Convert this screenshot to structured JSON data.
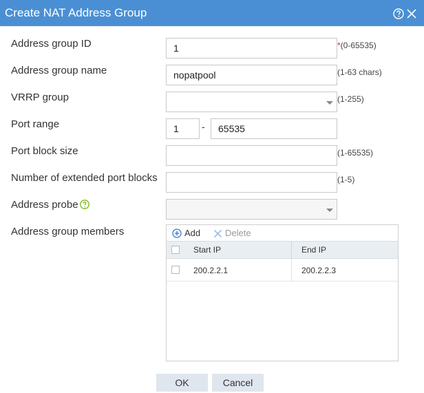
{
  "dialog": {
    "title": "Create NAT Address Group"
  },
  "fields": {
    "group_id": {
      "label": "Address group ID",
      "value": "1",
      "required_mark": "*",
      "hint": "(0-65535)"
    },
    "group_name": {
      "label": "Address group name",
      "value": "nopatpool",
      "hint": "(1-63 chars)"
    },
    "vrrp_group": {
      "label": "VRRP group",
      "value": "",
      "hint": "(1-255)"
    },
    "port_range": {
      "label": "Port range",
      "start": "1",
      "separator": "-",
      "end": "65535"
    },
    "port_block_size": {
      "label": "Port block size",
      "value": "",
      "hint": "(1-65535)"
    },
    "extended_blocks": {
      "label": "Number of extended port blocks",
      "value": "",
      "hint": "(1-5)"
    },
    "address_probe": {
      "label": "Address probe",
      "value": ""
    },
    "members": {
      "label": "Address group members",
      "add_label": "Add",
      "delete_label": "Delete",
      "columns": [
        "Start IP",
        "End IP"
      ],
      "rows": [
        {
          "start_ip": "200.2.2.1",
          "end_ip": "200.2.2.3"
        }
      ]
    }
  },
  "footer": {
    "ok_label": "OK",
    "cancel_label": "Cancel"
  },
  "colors": {
    "titlebar": "#4a8fd4",
    "required": "#e02020",
    "help_green": "#7ab51d",
    "add_blue": "#3a7fd0"
  }
}
